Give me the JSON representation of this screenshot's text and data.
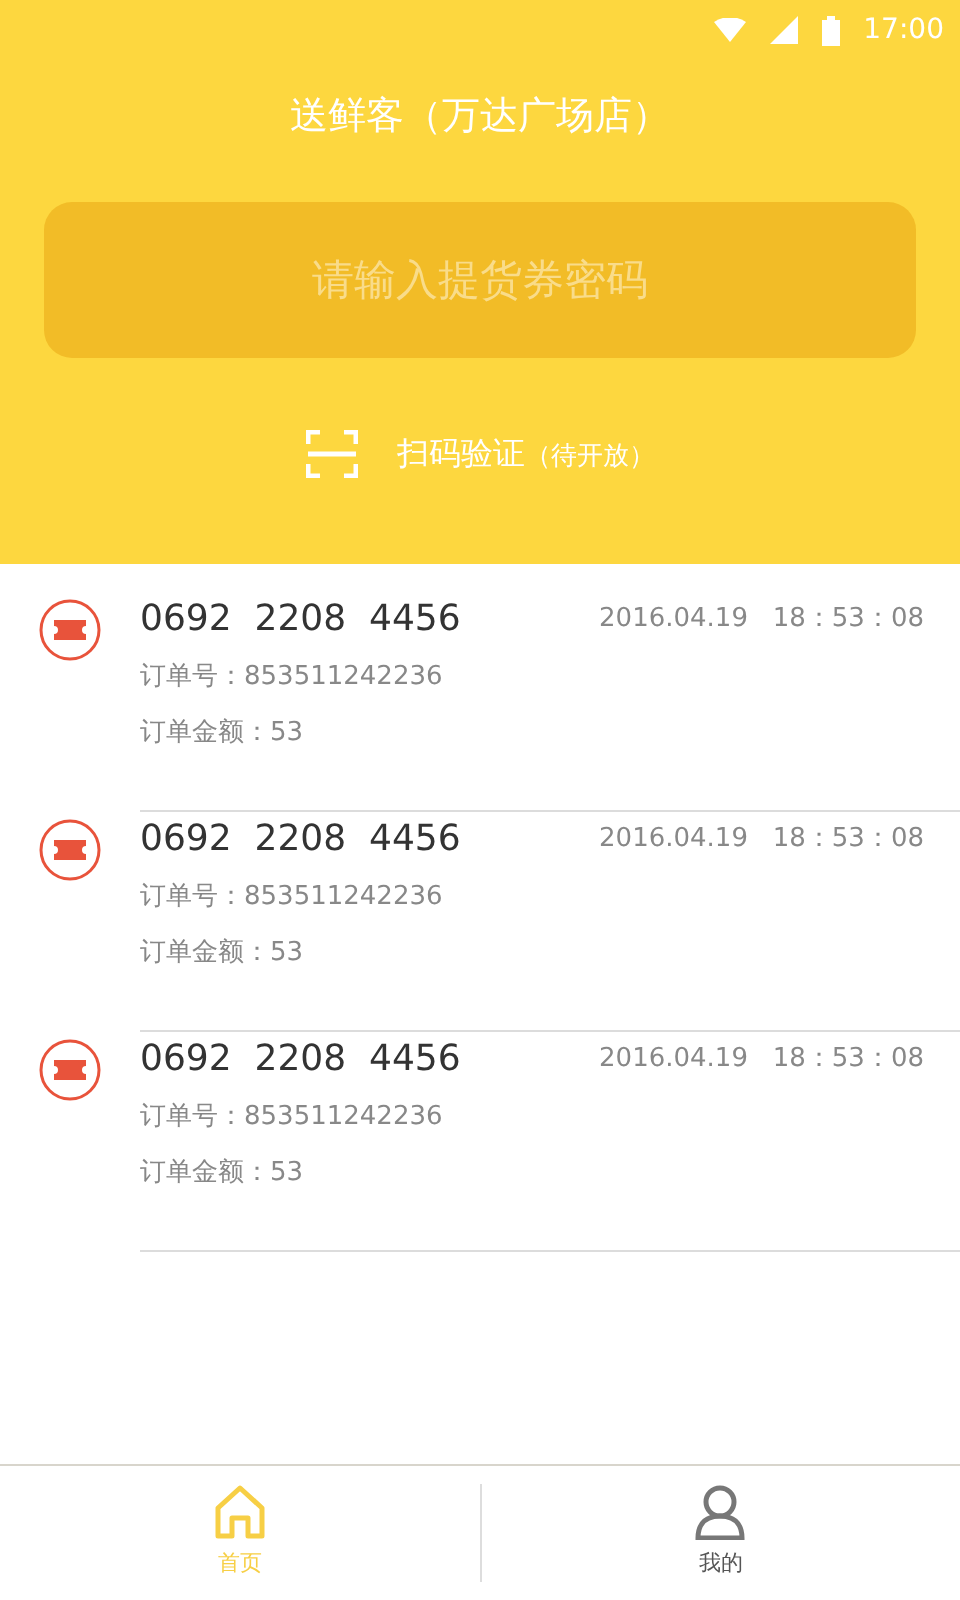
{
  "status_bar": {
    "time": "17:00"
  },
  "header": {
    "title": "送鲜客（万达广场店）",
    "input": {
      "placeholder": "请输入提货券密码"
    },
    "scan": {
      "label": "扫码验证",
      "note": "（待开放）"
    }
  },
  "vouchers": [
    {
      "code": "0692  2208  4456",
      "time": "2016.04.19   18：53：08",
      "order": "订单号：853511242236",
      "amount": "订单金额：53"
    },
    {
      "code": "0692  2208  4456",
      "time": "2016.04.19   18：53：08",
      "order": "订单号：853511242236",
      "amount": "订单金额：53"
    },
    {
      "code": "0692  2208  4456",
      "time": "2016.04.19   18：53：08",
      "order": "订单号：853511242236",
      "amount": "订单金额：53"
    }
  ],
  "tabs": [
    {
      "kind": "home",
      "label": "首页",
      "selected": true
    },
    {
      "kind": "profile",
      "label": "我的",
      "selected": false
    }
  ]
}
